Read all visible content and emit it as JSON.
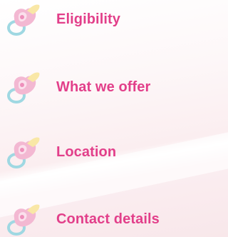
{
  "menu": {
    "items": [
      {
        "label": "Eligibility",
        "icon": "pacifier-icon"
      },
      {
        "label": "What we offer",
        "icon": "pacifier-icon"
      },
      {
        "label": "Location",
        "icon": "pacifier-icon"
      },
      {
        "label": "Contact details",
        "icon": "pacifier-icon"
      }
    ]
  },
  "colors": {
    "label": "#e23f8a",
    "pacifier_body": "#f3b8d2",
    "pacifier_ring": "#9fd8e2",
    "pacifier_nipple": "#f9e7a6"
  }
}
